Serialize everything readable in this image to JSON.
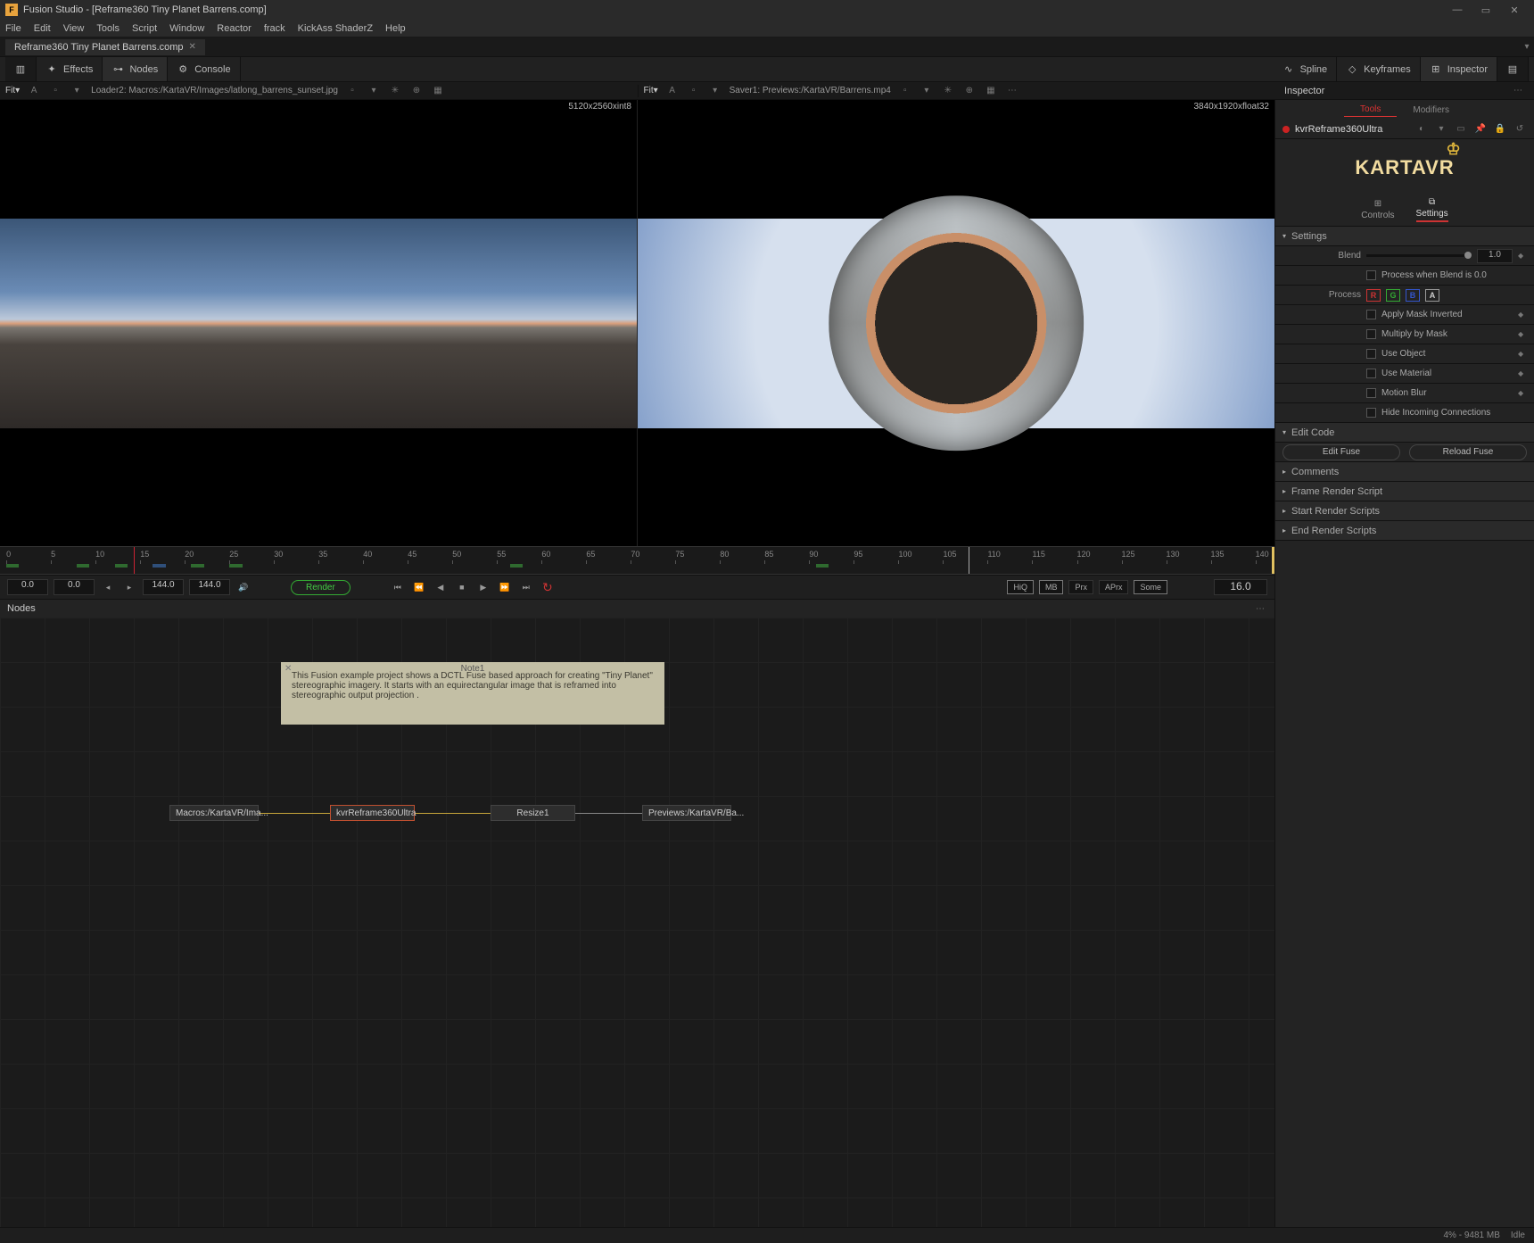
{
  "window": {
    "title": "Fusion Studio - [Reframe360 Tiny Planet Barrens.comp]"
  },
  "menus": [
    "File",
    "Edit",
    "View",
    "Tools",
    "Script",
    "Window",
    "Reactor",
    "frack",
    "KickAss ShaderZ",
    "Help"
  ],
  "doc_tab": "Reframe360 Tiny Planet Barrens.comp",
  "toolbar": {
    "effects": "Effects",
    "nodes": "Nodes",
    "console": "Console",
    "spline": "Spline",
    "keyframes": "Keyframes",
    "inspector": "Inspector"
  },
  "viewers": {
    "left": {
      "fit": "Fit▾",
      "meta": "Loader2: Macros:/KartaVR/Images/latlong_barrens_sunset.jpg",
      "overlay": "5120x2560xint8"
    },
    "right": {
      "fit": "Fit▾",
      "meta": "Saver1: Previews:/KartaVR/Barrens.mp4",
      "overlay": "3840x1920xfloat32"
    }
  },
  "inspector": {
    "title": "Inspector",
    "tabTools": "Tools",
    "tabModifiers": "Modifiers",
    "nodeName": "kvrReframe360Ultra",
    "logoText": "KARTAVR",
    "controls": "Controls",
    "settings": "Settings",
    "sectionSettings": "Settings",
    "blendLabel": "Blend",
    "blendValue": "1.0",
    "processWhen": "Process when Blend is 0.0",
    "processLabel": "Process",
    "chR": "R",
    "chG": "G",
    "chB": "B",
    "chA": "A",
    "applyMask": "Apply Mask Inverted",
    "multMask": "Multiply by Mask",
    "useObject": "Use Object",
    "useMaterial": "Use Material",
    "motionBlur": "Motion Blur",
    "hideConn": "Hide Incoming Connections",
    "editCode": "Edit Code",
    "editFuse": "Edit Fuse",
    "reloadFuse": "Reload Fuse",
    "comments": "Comments",
    "frameRender": "Frame Render Script",
    "startRender": "Start Render Scripts",
    "endRender": "End Render Scripts"
  },
  "timeline": {
    "ticks": [
      "0",
      "5",
      "10",
      "15",
      "20",
      "25",
      "30",
      "35",
      "40",
      "45",
      "50",
      "55",
      "60",
      "65",
      "70",
      "75",
      "80",
      "85",
      "90",
      "95",
      "100",
      "105",
      "110",
      "115",
      "120",
      "125",
      "130",
      "135",
      "140"
    ]
  },
  "transport": {
    "cur1": "0.0",
    "cur2": "0.0",
    "end1": "144.0",
    "end2": "144.0",
    "render": "Render",
    "hiq": "HiQ",
    "mb": "MB",
    "prx": "Prx",
    "aprx": "APrx",
    "some": "Some",
    "gt": "16.0"
  },
  "nodes": {
    "panelTitle": "Nodes",
    "noteTitle": "Note1",
    "noteText": "This Fusion example project shows a DCTL Fuse based approach for creating \"Tiny Planet\" stereographic imagery. It starts with an equirectangular image that is reframed into stereographic output projection .",
    "n1": "Macros:/KartaVR/Ima...",
    "n2": "kvrReframe360Ultra",
    "n3": "Resize1",
    "n4": "Previews:/KartaVR/Ba..."
  },
  "status": {
    "mem": "4% - 9481 MB",
    "state": "Idle"
  }
}
